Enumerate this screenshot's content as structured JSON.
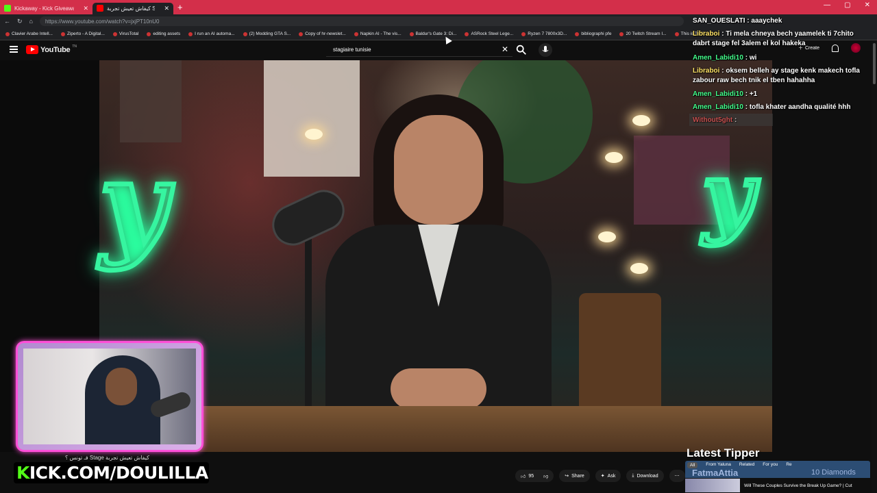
{
  "browser": {
    "tabs": [
      {
        "label": "Kickaway - Kick Giveaway Tool"
      },
      {
        "label": "كيفاش تعيش تجربة Stage_فـ..."
      }
    ],
    "url": "https://www.youtube.com/watch?v=jxjPT10nU0",
    "bookmarks": [
      "Clavier Arabe Intell...",
      "Ziperto - A Digital...",
      "VirusTotal",
      "editing assets",
      "I run an AI automa...",
      "(2) Modding GTA S...",
      "Copy of hr-newslet...",
      "Napkin AI - The vis...",
      "Baldur's Gate 3: Di...",
      "ASRock Steel Lege...",
      "Ryzen 7 7800x3D...",
      "bibliographi pfe",
      "20 Twitch Stream I...",
      "This is Tuni..."
    ]
  },
  "youtube": {
    "logo_text": "YouTube",
    "country": "TN",
    "search_query": "stagiaire tunisie",
    "create_label": "Create",
    "like_count": "95",
    "share_label": "Share",
    "ask_label": "Ask",
    "download_label": "Download",
    "related_tabs": [
      "All",
      "From Yaluna",
      "Related",
      "For you",
      "Re"
    ],
    "suggestion_title": "Will These Couples Survive the Break Up Game? | Cut"
  },
  "chat": {
    "lines": [
      {
        "user": "SAN_OUESLATI",
        "text": "aaaychek"
      },
      {
        "user": "Libraboi",
        "text": "Ti mela chneya bech yaamelek ti 7chito dabrt stage fel 3alem el kol hakeka"
      },
      {
        "user": "Amen_Labidi10",
        "text": "wi"
      },
      {
        "user": "Libraboi",
        "text": "oksem belleh ay stage kenk makech tofla zabour raw bech tnik el tben hahahha"
      },
      {
        "user": "Amen_Labidi10",
        "text": "+1"
      },
      {
        "user": "Amen_Labidi10",
        "text": "tofla khater aandha qualité hhh"
      },
      {
        "user": "Without5ght",
        "text": ""
      }
    ]
  },
  "stream": {
    "kick_url_prefix": "K",
    "kick_url_rest": "ICK.COM/DOULILLA",
    "caption": "فـ تونس ؟ Stage كيفاش تعيش تجربة",
    "tipper_title": "Latest Tipper",
    "tipper_name": "FatmaAttia",
    "tipper_amount": "10 Diamonds"
  },
  "colors": {
    "accent_red": "#d32f4a",
    "kick_green": "#53fc18",
    "cam_border": "#ff4fd8",
    "neon_green": "#36f5a0"
  }
}
